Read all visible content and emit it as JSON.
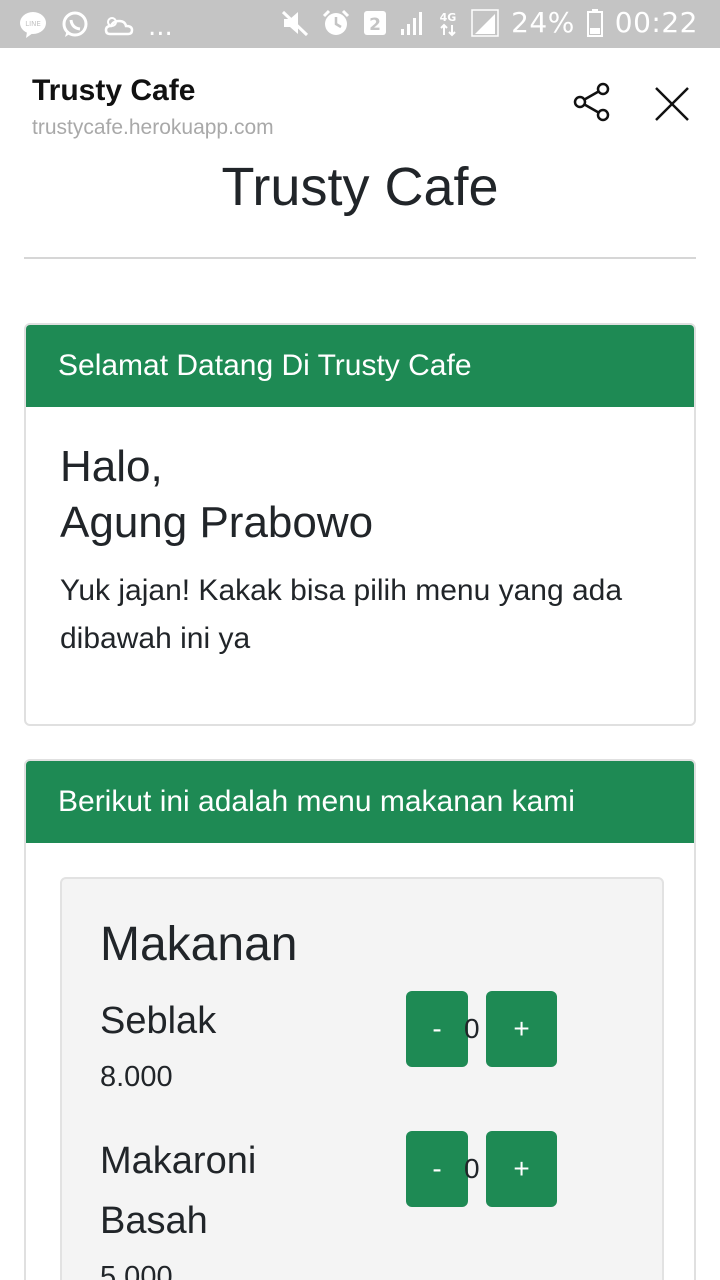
{
  "status_bar": {
    "left_icons": [
      "line-icon",
      "whatsapp-icon",
      "cloud-icon"
    ],
    "more": "...",
    "sim_badge": "2",
    "network": "4G",
    "battery_percent": "24%",
    "time": "00:22"
  },
  "browser": {
    "title": "Trusty Cafe",
    "url": "trustycafe.herokuapp.com"
  },
  "page": {
    "title": "Trusty Cafe"
  },
  "welcome_card": {
    "header": "Selamat Datang Di Trusty Cafe",
    "greeting_line1": "Halo,",
    "greeting_line2": "Agung Prabowo",
    "intro": "Yuk jajan! Kakak bisa pilih menu yang ada dibawah ini ya"
  },
  "menu_card": {
    "header": "Berikut ini adalah menu makanan kami",
    "category": "Makanan",
    "items": [
      {
        "name": "Seblak",
        "price": "8.000",
        "qty": "0",
        "minus": "-",
        "plus": "+"
      },
      {
        "name": "Makaroni Basah",
        "price": "5.000",
        "qty": "0",
        "minus": "-",
        "plus": "+"
      }
    ]
  },
  "colors": {
    "primary": "#1e8a54",
    "status_bar": "#c4c4c4",
    "url_text": "#a9a9a9"
  }
}
